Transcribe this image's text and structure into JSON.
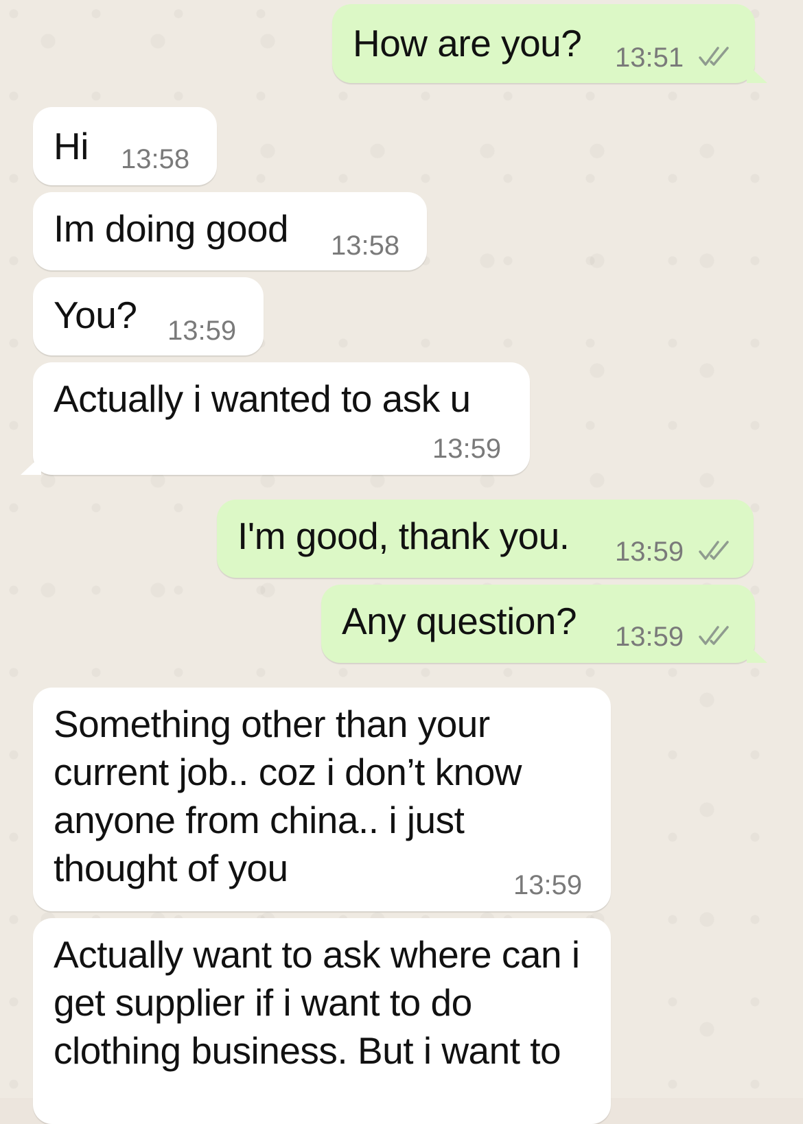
{
  "messages": [
    {
      "direction": "outgoing",
      "text": "How are you?",
      "time": "13:51",
      "status_icon": "double-check-icon"
    },
    {
      "direction": "incoming",
      "text": "Hi",
      "time": "13:58"
    },
    {
      "direction": "incoming",
      "text": "Im doing good",
      "time": "13:58"
    },
    {
      "direction": "incoming",
      "text": "You?",
      "time": "13:59"
    },
    {
      "direction": "incoming",
      "text": "Actually i wanted to ask u",
      "time": "13:59"
    },
    {
      "direction": "outgoing",
      "text": "I'm good, thank you.",
      "time": "13:59",
      "status_icon": "double-check-icon"
    },
    {
      "direction": "outgoing",
      "text": "Any question?",
      "time": "13:59",
      "status_icon": "double-check-icon"
    },
    {
      "direction": "incoming",
      "text": "Something other than your current job.. coz i don’t know anyone from china.. i just thought of you",
      "time": "13:59"
    },
    {
      "direction": "incoming",
      "text": "Actually want to ask where can i get supplier if i want to do clothing business. But i want to"
    }
  ],
  "colors": {
    "incoming_bubble": "#ffffff",
    "outgoing_bubble": "#dcf8c6",
    "timestamp": "#7a7a7a",
    "wallpaper": "#efeae2"
  }
}
